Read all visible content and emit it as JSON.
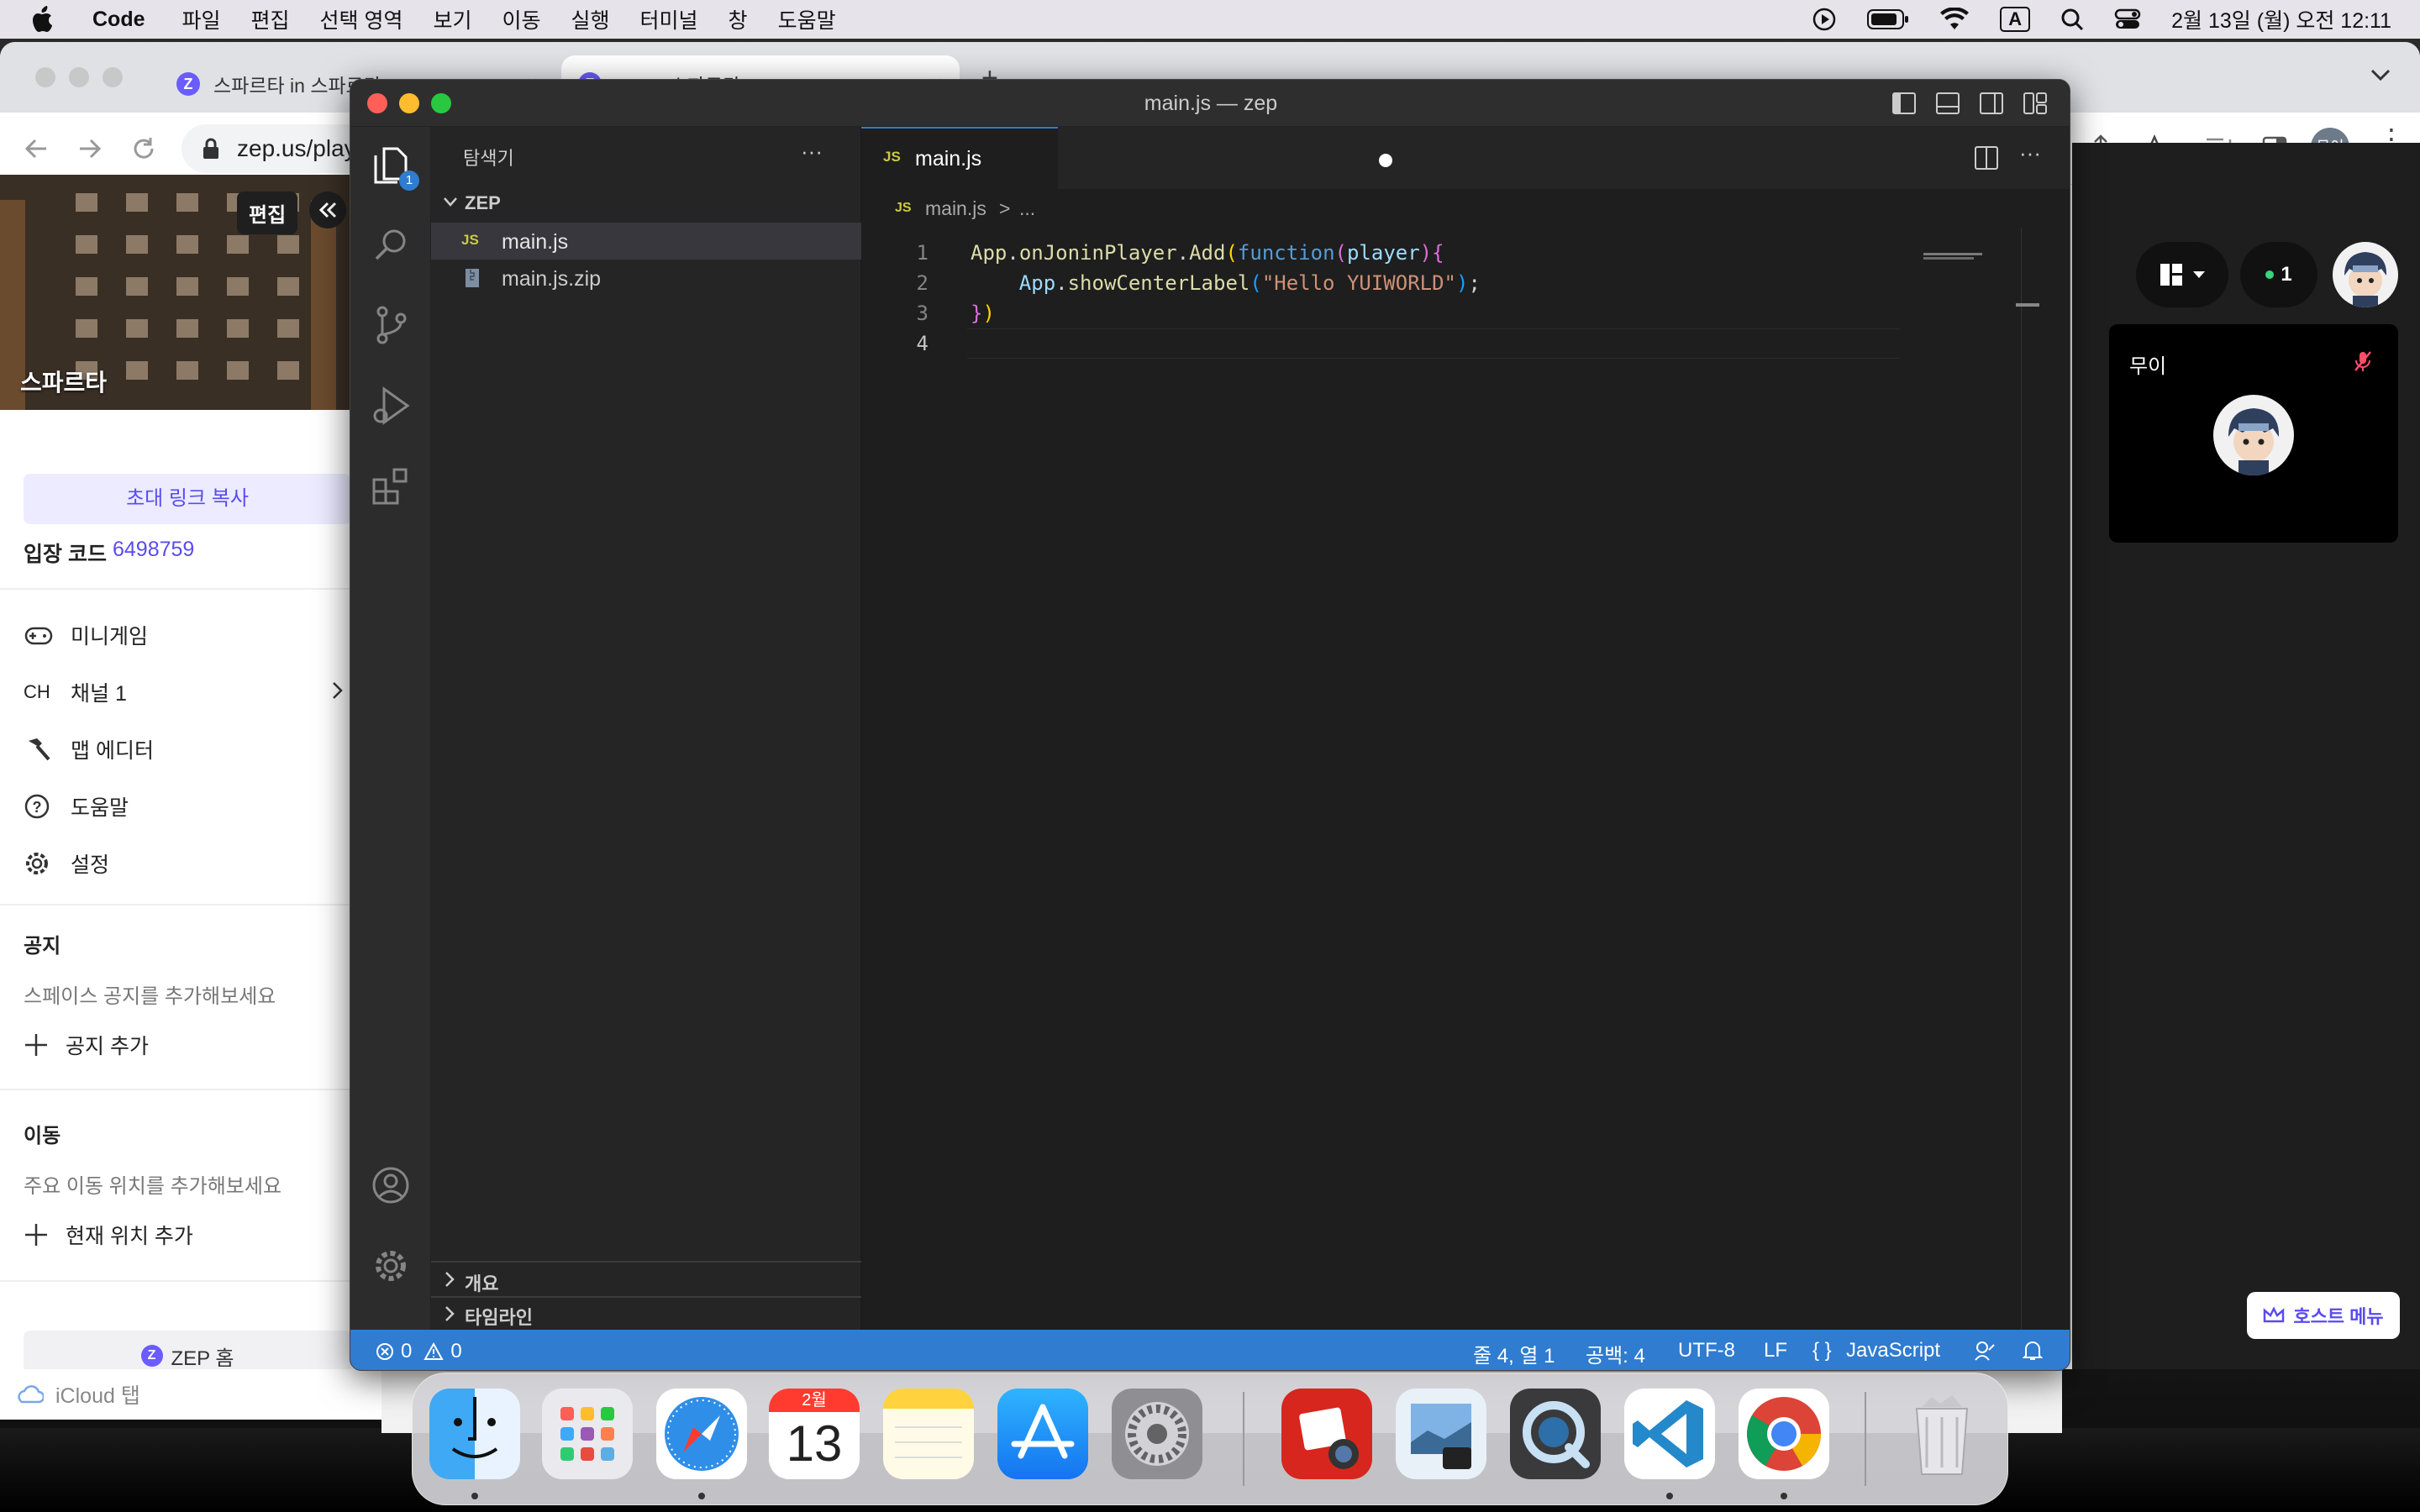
{
  "menubar": {
    "app_name": "Code",
    "items": [
      "파일",
      "편집",
      "선택 영역",
      "보기",
      "이동",
      "실행",
      "터미널",
      "창",
      "도움말"
    ],
    "input_indicator": "A",
    "clock": "2월 13일 (월) 오전 12:11"
  },
  "browser": {
    "tabs": [
      {
        "title": "스파르타 in 스파르타 - ZEP",
        "close": "×"
      },
      {
        "title": "ZEP - 스파르타",
        "close": "×"
      }
    ],
    "new_tab": "+",
    "url": "zep.us/play",
    "profile": "무이",
    "icloud_tabs": "iCloud 탭"
  },
  "zep": {
    "space_name": "스파르타",
    "edit_label": "편집",
    "collapse_icon": "double-chevron-left-icon",
    "invite_button": "초대 링크 복사",
    "entry_code_label": "입장 코드",
    "entry_code": "6498759",
    "menu": [
      {
        "icon": "gamepad-icon",
        "label": "미니게임"
      },
      {
        "icon": "ch-icon",
        "prefix": "CH",
        "label": "채널 1"
      },
      {
        "icon": "hammer-icon",
        "label": "맵 에디터"
      },
      {
        "icon": "help-icon",
        "label": "도움말"
      },
      {
        "icon": "gear-icon",
        "label": "설정"
      }
    ],
    "notice_title": "공지",
    "notice_hint": "스페이스 공지를 추가해보세요",
    "notice_add": "공지 추가",
    "move_title": "이동",
    "move_hint": "주요 이동 위치를 추가해보세요",
    "move_add": "현재 위치 추가",
    "home_button": "ZEP 홈",
    "online_count": "1",
    "video_name": "무이",
    "host_menu": "호스트 메뉴"
  },
  "vscode": {
    "window_title": "main.js — zep",
    "explorer_title": "탐색기",
    "explorer_more": "···",
    "folder_name": "ZEP",
    "files": [
      {
        "name": "main.js",
        "icon": "JS",
        "selected": true
      },
      {
        "name": "main.js.zip",
        "icon": "zip-file-icon",
        "selected": false
      }
    ],
    "outline_label": "개요",
    "timeline_label": "타임라인",
    "explorer_badge": "1",
    "tab_name": "main.js",
    "tab_icon": "JS",
    "breadcrumb_file": "main.js",
    "breadcrumb_sep": ">",
    "breadcrumb_more": "...",
    "editor_more": "···",
    "code_lines": [
      {
        "n": "1",
        "tokens": [
          [
            "App",
            "#dcdcaa"
          ],
          [
            ".",
            "#d4d4d4"
          ],
          [
            "onJoninPlayer",
            "#dcdcaa"
          ],
          [
            ".",
            "#d4d4d4"
          ],
          [
            "Add",
            "#dcdcaa"
          ],
          [
            "(",
            "#ffd700"
          ],
          [
            "function",
            "#569cd6"
          ],
          [
            "(",
            "#da70d6"
          ],
          [
            "player",
            "#9cdcfe"
          ],
          [
            ")",
            "#da70d6"
          ],
          [
            "{",
            "#da70d6"
          ]
        ]
      },
      {
        "n": "2",
        "tokens": [
          [
            "    App",
            "#9cdcfe"
          ],
          [
            ".",
            "#d4d4d4"
          ],
          [
            "showCenterLabel",
            "#dcdcaa"
          ],
          [
            "(",
            "#179fff"
          ],
          [
            "\"Hello YUIWORLD\"",
            "#ce9178"
          ],
          [
            ")",
            "#179fff"
          ],
          [
            ";",
            "#d4d4d4"
          ]
        ]
      },
      {
        "n": "3",
        "tokens": [
          [
            "}",
            "#da70d6"
          ],
          [
            ")",
            "#ffd700"
          ]
        ]
      },
      {
        "n": "4",
        "tokens": []
      }
    ],
    "status": {
      "errors": "0",
      "warnings": "0",
      "position": "줄 4, 열 1",
      "spaces": "공백: 4",
      "encoding": "UTF-8",
      "eol": "LF",
      "lang_braces": "{ }",
      "language": "JavaScript"
    }
  },
  "dock": {
    "calendar_month": "2월",
    "calendar_day": "13",
    "apps": [
      "finder-icon",
      "launchpad-icon",
      "safari-icon",
      "calendar-icon",
      "notes-icon",
      "app-store-icon",
      "system-settings-icon",
      "photo-booth-icon",
      "preview-icon",
      "quicktime-icon",
      "vscode-icon",
      "chrome-icon",
      "trash-icon"
    ]
  }
}
